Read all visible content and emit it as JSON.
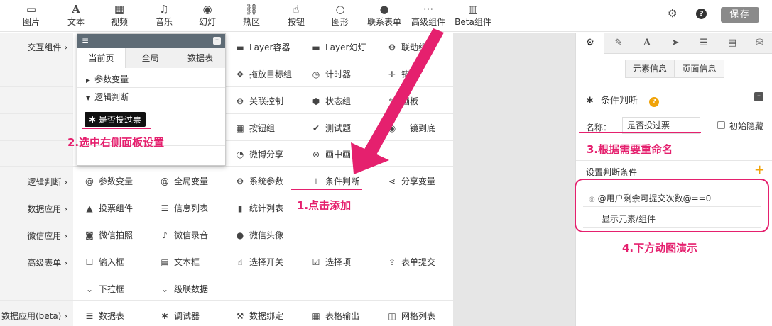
{
  "toolbar": {
    "items": [
      {
        "label": "图片",
        "icon": "image-icon"
      },
      {
        "label": "文本",
        "icon": "text-icon"
      },
      {
        "label": "视频",
        "icon": "video-icon"
      },
      {
        "label": "音乐",
        "icon": "music-icon"
      },
      {
        "label": "幻灯",
        "icon": "slideshow-icon"
      },
      {
        "label": "热区",
        "icon": "link-icon"
      },
      {
        "label": "按钮",
        "icon": "hand-pointer-icon"
      },
      {
        "label": "图形",
        "icon": "circle-icon"
      },
      {
        "label": "联系表单",
        "icon": "user-icon"
      },
      {
        "label": "高级组件",
        "icon": "ellipsis-icon"
      },
      {
        "label": "Beta组件",
        "icon": "building-icon"
      }
    ],
    "save_label": "保存"
  },
  "left_nav": {
    "categories": [
      "交互组件",
      "逻辑判断",
      "数据应用",
      "微信应用",
      "高级表单",
      "数据应用(beta)"
    ]
  },
  "components": {
    "interactive": [
      {
        "label": "Layer容器",
        "icon": "layer-icon"
      },
      {
        "label": "Layer幻灯",
        "icon": "layer-slide-icon"
      },
      {
        "label": "联动组件",
        "icon": "cogs-icon"
      },
      {
        "label": "拖放目标组",
        "icon": "move-icon"
      },
      {
        "label": "计时器",
        "icon": "timer-icon"
      },
      {
        "label": "锚点",
        "icon": "anchor-icon"
      },
      {
        "label": "关联控制",
        "icon": "cogs-icon"
      },
      {
        "label": "状态组",
        "icon": "cubes-icon"
      },
      {
        "label": "画板",
        "icon": "edit-icon"
      },
      {
        "label": "按钮组",
        "icon": "grid-icon"
      },
      {
        "label": "测试题",
        "icon": "check-circle-icon"
      },
      {
        "label": "一镜到底",
        "icon": "dot-circle-icon"
      },
      {
        "label": "微博分享",
        "icon": "weibo-icon"
      },
      {
        "label": "画中画",
        "icon": "lifebuoy-icon"
      }
    ],
    "logic": [
      {
        "label": "参数变量",
        "icon": "at-icon"
      },
      {
        "label": "全局变量",
        "icon": "at-icon"
      },
      {
        "label": "系统参数",
        "icon": "gear-icon"
      },
      {
        "label": "条件判断",
        "icon": "sitemap-icon"
      },
      {
        "label": "分享变量",
        "icon": "share-icon"
      }
    ],
    "data_apps": [
      {
        "label": "投票组件",
        "icon": "thumbs-up-icon"
      },
      {
        "label": "信息列表",
        "icon": "list-icon"
      },
      {
        "label": "统计列表",
        "icon": "bar-chart-icon"
      }
    ],
    "wechat": [
      {
        "label": "微信拍照",
        "icon": "camera-icon"
      },
      {
        "label": "微信录音",
        "icon": "microphone-icon"
      },
      {
        "label": "微信头像",
        "icon": "user-icon"
      }
    ],
    "advanced_form": [
      {
        "label": "输入框",
        "icon": "square-icon"
      },
      {
        "label": "文本框",
        "icon": "textarea-icon"
      },
      {
        "label": "选择开关",
        "icon": "hand-pointer-icon"
      },
      {
        "label": "选择项",
        "icon": "check-square-icon"
      },
      {
        "label": "表单提交",
        "icon": "upload-icon"
      },
      {
        "label": "下拉框",
        "icon": "chevron-circle-icon"
      },
      {
        "label": "级联数据",
        "icon": "chevron-circle-icon"
      }
    ],
    "data_beta": [
      {
        "label": "数据表",
        "icon": "database-icon"
      },
      {
        "label": "调试器",
        "icon": "bug-icon"
      },
      {
        "label": "数据绑定",
        "icon": "wrench-icon"
      },
      {
        "label": "表格输出",
        "icon": "table-icon"
      },
      {
        "label": "网格列表",
        "icon": "columns-icon"
      }
    ]
  },
  "popup": {
    "tabs": [
      "当前页",
      "全局",
      "数据表"
    ],
    "tree_item_1": "参数变量",
    "tree_item_2": "逻辑判断",
    "selected_item": "是否投过票"
  },
  "right_panel": {
    "segments": [
      "元素信息",
      "页面信息"
    ],
    "section_title": "条件判断",
    "name_label": "名称：",
    "name_value": "是否投过票",
    "initial_hidden_label": "初始隐藏",
    "conditions_label": "设置判断条件",
    "condition_expr": "@用户剩余可提交次数@==0",
    "action_label": "显示元素/组件"
  },
  "annotations": {
    "a1": "1.点击添加",
    "a2": "2.选中右侧面板设置",
    "a3": "3.根据需要重命名",
    "a4": "4.下方动图演示"
  },
  "colors": {
    "accent": "#e5206e",
    "help": "#f0a30a"
  }
}
